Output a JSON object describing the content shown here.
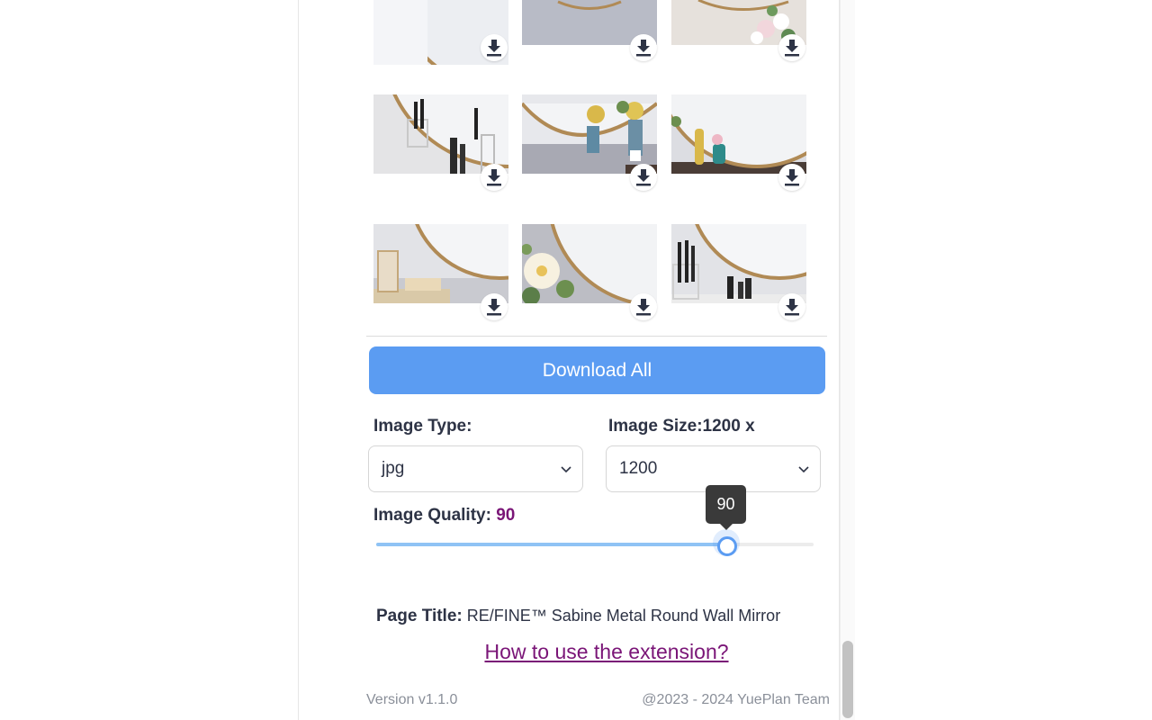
{
  "download_all_label": "Download All",
  "image_type": {
    "label": "Image Type:",
    "selected": "jpg"
  },
  "image_size": {
    "label": "Image Size:1200 x",
    "selected": "1200"
  },
  "image_quality": {
    "label": "Image Quality:",
    "value": "90",
    "fraction": 0.9
  },
  "tooltip": "90",
  "page_title": {
    "label": "Page Title:",
    "value": "RE/FINE™ Sabine Metal Round Wall Mirror"
  },
  "howto_link": "How to use the extension?",
  "footer": {
    "version": "Version v1.1.0",
    "credit": "@2023 - 2024 YuePlan Team"
  },
  "colors": {
    "accent": "#5b9cf2",
    "link": "#7a1577",
    "text": "#2d3345",
    "muted": "#8a8f99"
  },
  "icons": {
    "download": "download-icon",
    "chevron": "chevron-down-icon"
  }
}
